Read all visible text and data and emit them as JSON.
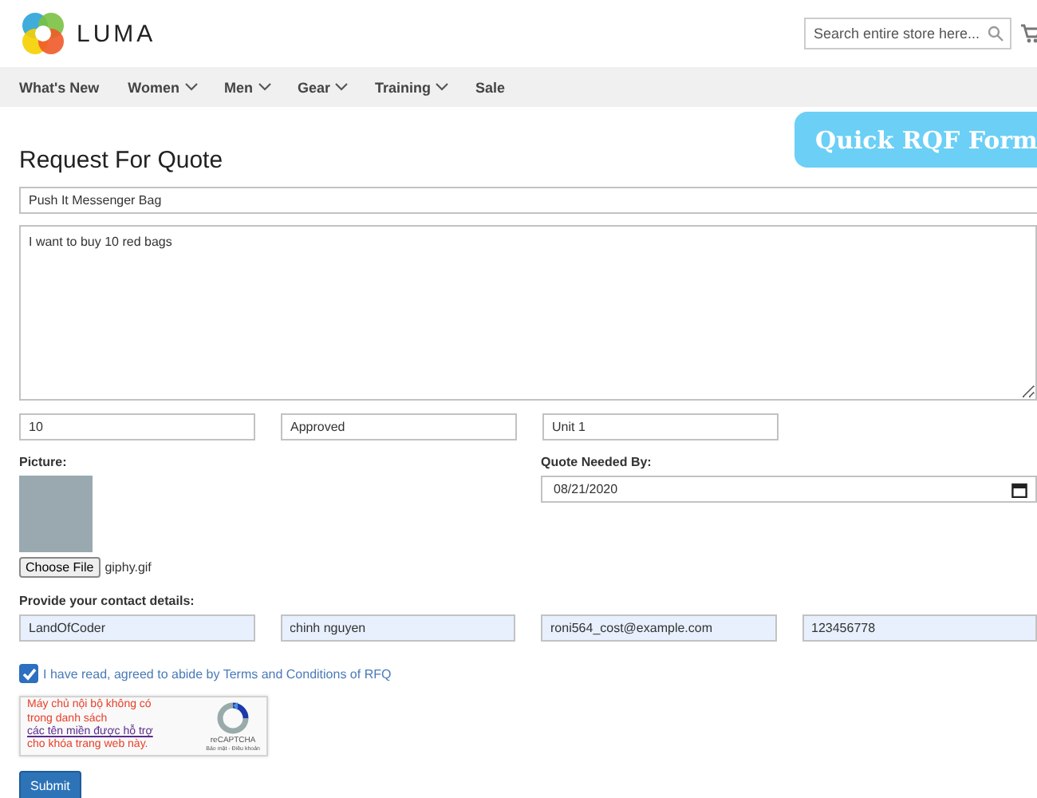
{
  "header": {
    "logo": "LUMA",
    "search": {
      "placeholder": "Search entire store here..."
    }
  },
  "nav": [
    {
      "label": "What's New",
      "dropdown": false
    },
    {
      "label": "Women",
      "dropdown": true
    },
    {
      "label": "Men",
      "dropdown": true
    },
    {
      "label": "Gear",
      "dropdown": true
    },
    {
      "label": "Training",
      "dropdown": true
    },
    {
      "label": "Sale",
      "dropdown": false
    }
  ],
  "badge": "Quick RQF Form",
  "form": {
    "title": "Request For Quote",
    "product": "Push It Messenger Bag",
    "message": "I want to buy 10 red bags",
    "fields": [
      {
        "value": "10"
      },
      {
        "value": "Approved"
      },
      {
        "value": "Unit 1"
      }
    ],
    "picture_label": "Picture:",
    "file_button": "Choose File",
    "file_name": "giphy.gif",
    "date_label": "Quote Needed By:",
    "date": "08/21/2020",
    "contact_label": "Provide your contact details:",
    "contact": [
      {
        "value": "LandOfCoder",
        "autofilled": true
      },
      {
        "value": "chinh nguyen",
        "autofilled": true
      },
      {
        "value": "roni564_cost@example.com",
        "autofilled": true
      },
      {
        "value": "123456778",
        "autofilled": true
      }
    ],
    "agree": {
      "checked": true,
      "label": "I have read, agreed to abide by Terms and Conditions of RFQ"
    },
    "captcha": {
      "message_before": "Máy chủ nội bộ không có trong danh sách",
      "message_link": "các tên miền được hỗ trợ",
      "message_after": "cho khóa trang web này.",
      "brand": "reCAPTCHA",
      "links": "Bảo mật - Điều khoản"
    },
    "submit": "Submit"
  }
}
